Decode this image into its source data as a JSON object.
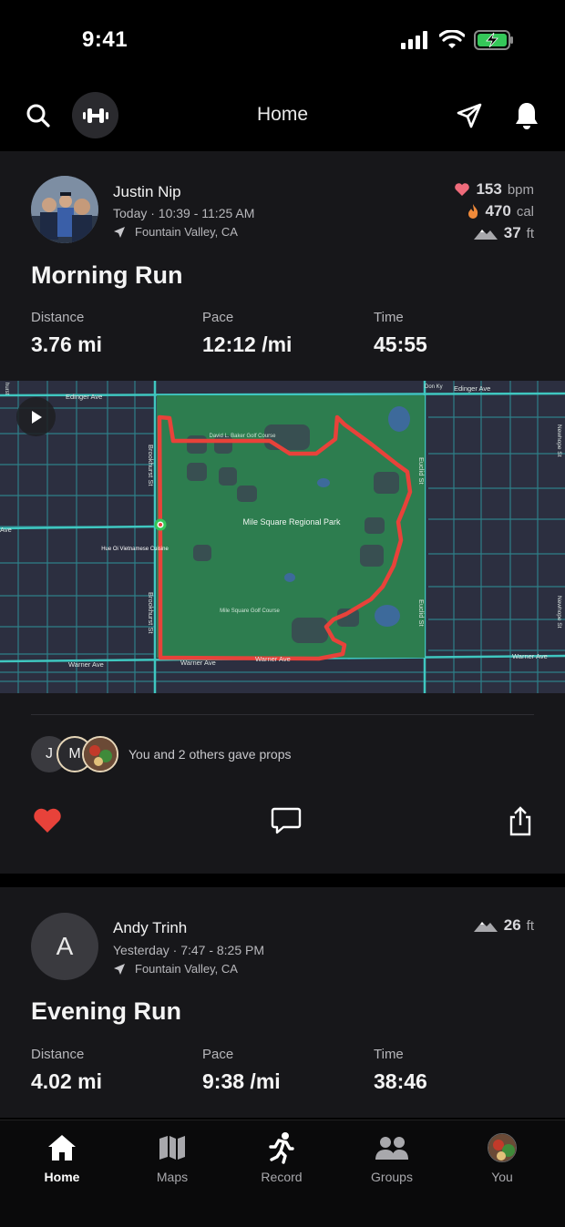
{
  "status": {
    "time": "9:41"
  },
  "header": {
    "title": "Home"
  },
  "activities": [
    {
      "athlete": "Justin Nip",
      "when": "Today · 10:39 - 11:25 AM",
      "location": "Fountain Valley, CA",
      "heart_rate": {
        "value": "153",
        "unit": "bpm"
      },
      "calories": {
        "value": "470",
        "unit": "cal"
      },
      "elevation": {
        "value": "37",
        "unit": "ft"
      },
      "title": "Morning Run",
      "stats": [
        {
          "label": "Distance",
          "value": "3.76 mi"
        },
        {
          "label": "Pace",
          "value": "12:12 /mi"
        },
        {
          "label": "Time",
          "value": "45:55"
        }
      ],
      "map_labels": {
        "edinger_w": "Edinger Ave",
        "edinger_e": "Edinger Ave",
        "warner_w": "Warner Ave",
        "warner_c": "Warner Ave",
        "warner_c2": "Warner Ave",
        "warner_e": "Warner Ave",
        "brookhurst_n": "Brookhurst St",
        "brookhurst_s": "Brookhurst St",
        "euclid_n": "Euclid St",
        "euclid_s": "Euclid St",
        "newhope_n": "Newhope St",
        "newhope_s": "Newhope St",
        "park": "Mile Square Regional Park",
        "golf_north": "David L. Baker Golf Course",
        "golf_south": "Mile Square Golf Course",
        "cuisine": "Hue Oi Vietnamese Cuisine",
        "don_ky": "Don Ky",
        "ave": "Ave",
        "hurst": "hurst"
      },
      "props": {
        "avatars": [
          "J",
          "M"
        ],
        "text": "You and 2 others gave props"
      }
    },
    {
      "athlete": "Andy Trinh",
      "avatar_letter": "A",
      "when": "Yesterday · 7:47 - 8:25 PM",
      "location": "Fountain Valley, CA",
      "elevation": {
        "value": "26",
        "unit": "ft"
      },
      "title": "Evening Run",
      "stats": [
        {
          "label": "Distance",
          "value": "4.02 mi"
        },
        {
          "label": "Pace",
          "value": "9:38 /mi"
        },
        {
          "label": "Time",
          "value": "38:46"
        }
      ]
    }
  ],
  "tabs": [
    {
      "label": "Home",
      "icon": "home-icon",
      "active": true
    },
    {
      "label": "Maps",
      "icon": "map-icon",
      "active": false
    },
    {
      "label": "Record",
      "icon": "runner-icon",
      "active": false
    },
    {
      "label": "Groups",
      "icon": "groups-icon",
      "active": false
    },
    {
      "label": "You",
      "icon": "profile-avatar",
      "active": false
    }
  ],
  "colors": {
    "accent": "#e8423a",
    "park": "#2d7d4f",
    "card": "#17171a"
  }
}
